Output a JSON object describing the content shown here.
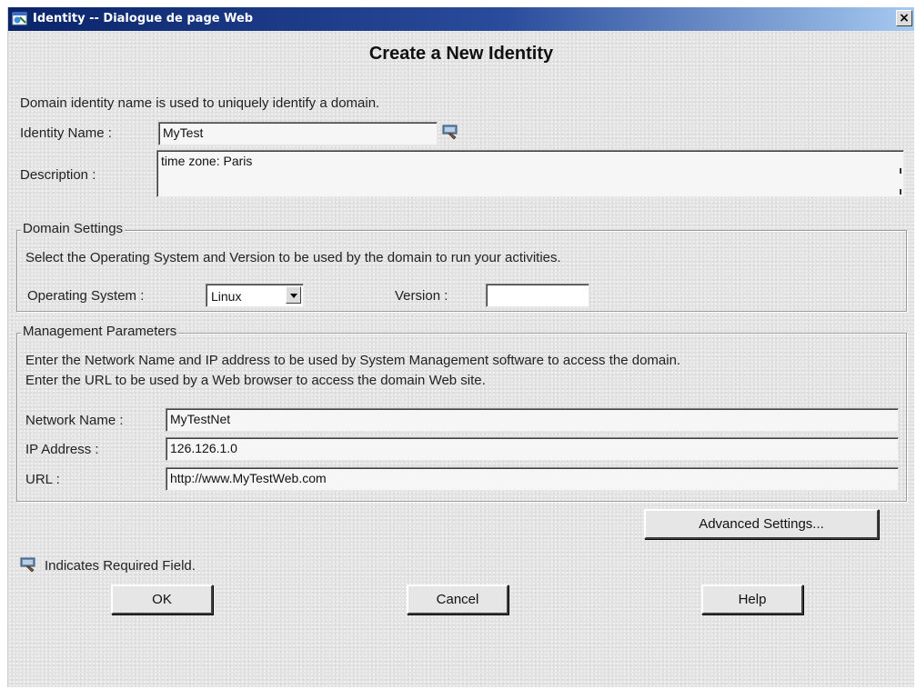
{
  "window": {
    "title": "Identity -- Dialogue de page Web",
    "close_glyph": "×"
  },
  "heading": "Create a New Identity",
  "intro_text": "Domain identity name is used to uniquely identify a domain.",
  "identity": {
    "name_label": "Identity Name :",
    "name_value": "MyTest",
    "description_label": "Description :",
    "description_value": "time zone: Paris"
  },
  "domain_settings": {
    "legend": "Domain Settings",
    "help_text": "Select the Operating System and Version to be used by the domain to run your activities.",
    "os_label": "Operating System :",
    "os_selected": "Linux",
    "version_label": "Version :",
    "version_value": ""
  },
  "management": {
    "legend": "Management Parameters",
    "help_line1": "Enter the Network Name and IP address to be used by System Management software to access the domain.",
    "help_line2": "Enter the URL to be used by a Web browser to access the domain Web site.",
    "network_label": "Network Name :",
    "network_value": "MyTestNet",
    "ip_label": "IP Address :",
    "ip_value": "126.126.1.0",
    "url_label": "URL :",
    "url_value": "http://www.MyTestWeb.com"
  },
  "buttons": {
    "advanced": "Advanced Settings...",
    "ok": "OK",
    "cancel": "Cancel",
    "help": "Help"
  },
  "required_note": "Indicates Required Field.",
  "icons": {
    "required": "required-field-icon",
    "window": "web-dialog-icon"
  }
}
